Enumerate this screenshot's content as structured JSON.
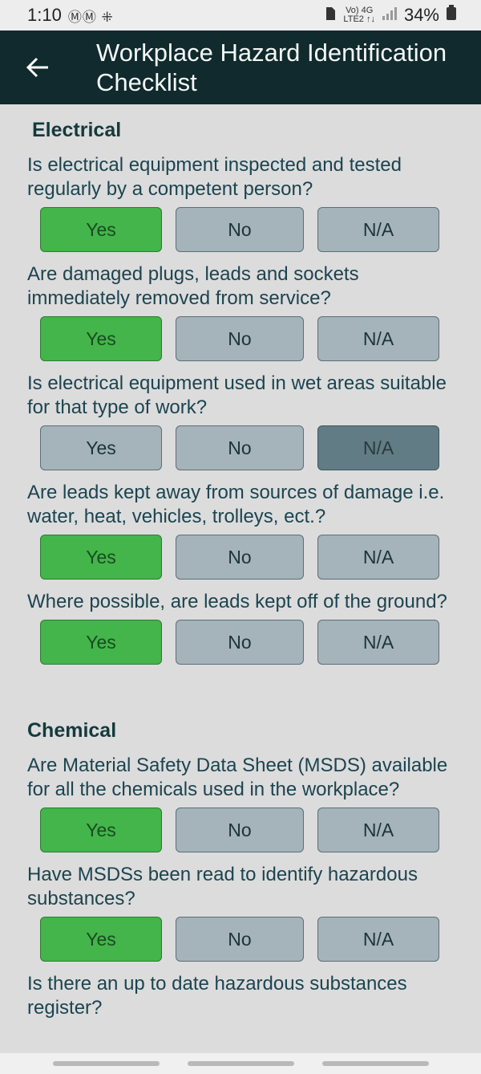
{
  "status_bar": {
    "time": "1:10",
    "left_icons": "ⓂⓂ ⁜",
    "net_top": "Vo) 4G",
    "net_bottom": "LTE2 ↑↓",
    "battery": "34%"
  },
  "header": {
    "title": "Workplace Hazard Identification Checklist"
  },
  "sections": [
    {
      "title": "Electrical",
      "questions": [
        {
          "text": "Is electrical equipment inspected and tested regularly by a competent person?",
          "selected": "Yes"
        },
        {
          "text": "Are damaged plugs, leads and sockets immediately removed from service?",
          "selected": "Yes"
        },
        {
          "text": "Is  electrical equipment used in wet areas suitable for that type of work?",
          "selected": "N/A"
        },
        {
          "text": "Are leads kept away from sources of damage i.e. water, heat, vehicles, trolleys, ect.?",
          "selected": "Yes"
        },
        {
          "text": "Where possible, are leads kept off of the ground?",
          "selected": "Yes"
        }
      ]
    },
    {
      "title": "Chemical",
      "questions": [
        {
          "text": "Are Material Safety Data Sheet (MSDS) available for all the chemicals used in the workplace?",
          "selected": "Yes"
        },
        {
          "text": "Have MSDSs been read to identify hazardous substances?",
          "selected": "Yes"
        },
        {
          "text": "Is there an up to date hazardous substances register?",
          "selected": ""
        }
      ]
    }
  ],
  "options": {
    "yes": "Yes",
    "no": "No",
    "na": "N/A"
  },
  "colors": {
    "app_bar": "#102a2d",
    "selected_yes": "#43b54a",
    "selected_na": "#627c86",
    "unselected": "#a5b3ba"
  }
}
